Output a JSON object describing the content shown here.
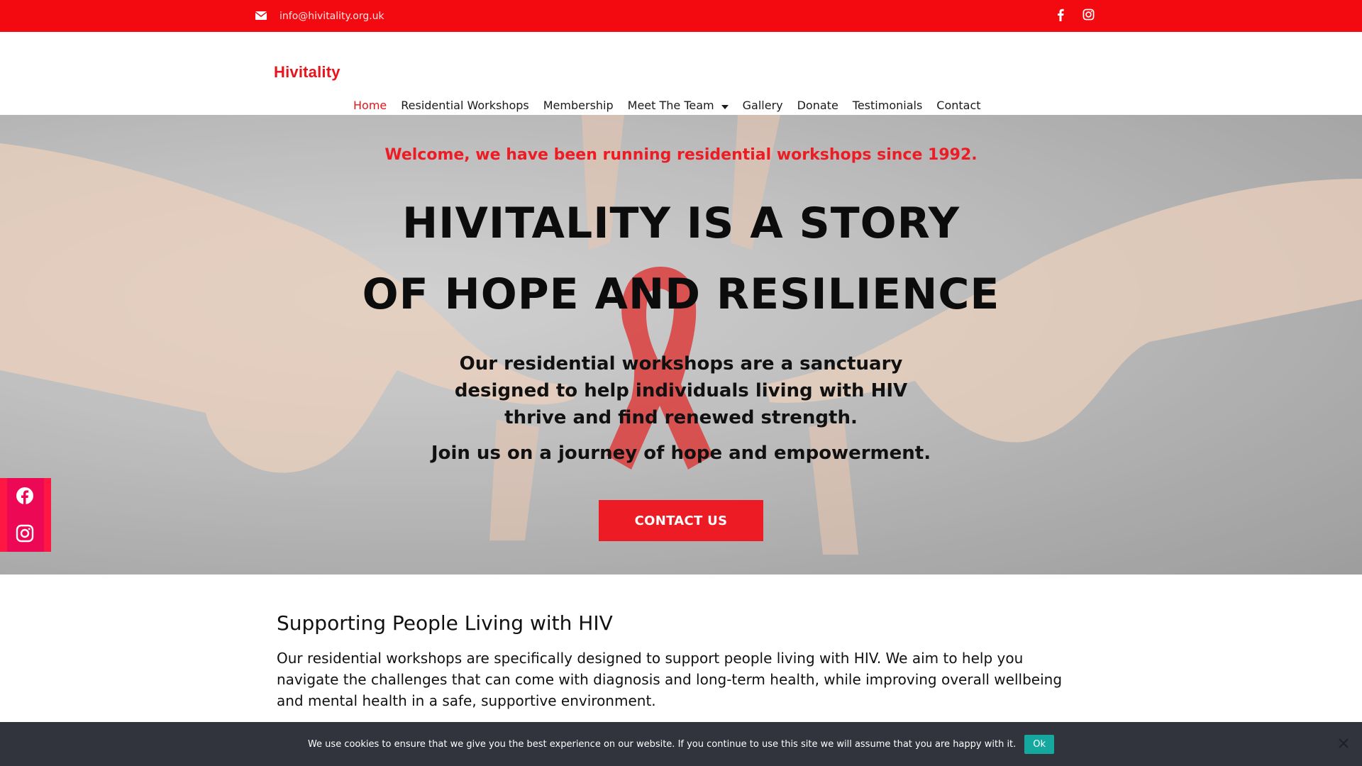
{
  "topbar": {
    "email": "info@hivitality.org.uk",
    "icons": [
      "envelope-icon",
      "facebook-icon",
      "instagram-icon"
    ]
  },
  "nav": {
    "logo": "Hivitality",
    "items": [
      {
        "label": "Home",
        "active": true
      },
      {
        "label": "Residential Workshops"
      },
      {
        "label": "Membership"
      },
      {
        "label": "Meet The Team",
        "has_dropdown": true
      },
      {
        "label": "Gallery"
      },
      {
        "label": "Donate"
      },
      {
        "label": "Testimonials"
      },
      {
        "label": "Contact"
      }
    ]
  },
  "hero": {
    "welcome": "Welcome, we have been running residential workshops since 1992.",
    "headline_line1": "HIVITALITY IS A STORY",
    "headline_line2": "OF HOPE AND RESILIENCE",
    "paragraph": "Our residential workshops are a sanctuary designed to help individuals living with HIV thrive and find renewed strength.",
    "join": "Join us on a journey of hope and empowerment.",
    "cta": "CONTACT US"
  },
  "section": {
    "title": "Supporting People Living with HIV",
    "body": "Our residential workshops are specifically designed to support people living with HIV. We aim to help you navigate the challenges that can come with diagnosis and long-term health, while improving overall wellbeing and mental health in a safe, supportive environment."
  },
  "cookie": {
    "message": "We use cookies to ensure that we give you the best experience on our website. If you continue to use this site we will assume that you are happy with it.",
    "ok": "Ok"
  },
  "colors": {
    "brand_red": "#ed1c24",
    "topbar_red": "#f20a10",
    "cookie_bg": "#31333d",
    "ok_teal": "#14a89e"
  }
}
